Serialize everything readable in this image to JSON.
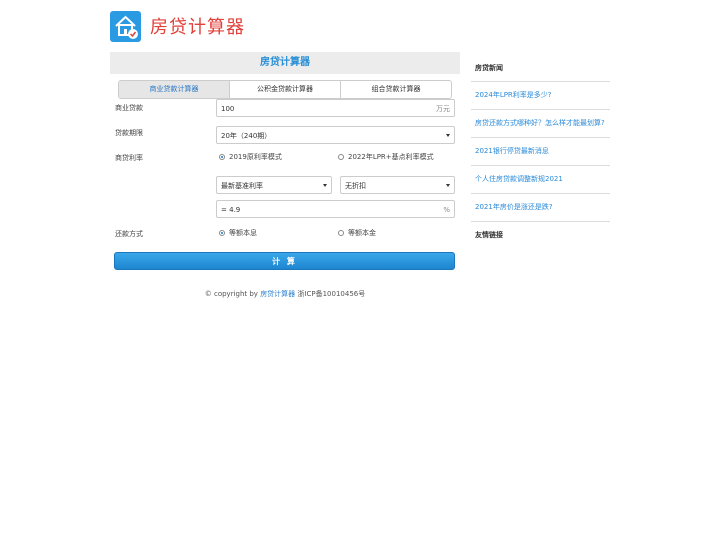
{
  "header": {
    "logo_icon": "house-icon",
    "site_title": "房贷计算器"
  },
  "panel": {
    "title": "房贷计算器"
  },
  "tabs": [
    {
      "label": "商业贷款计算器",
      "active": true
    },
    {
      "label": "公积金贷款计算器",
      "active": false
    },
    {
      "label": "组合贷款计算器",
      "active": false
    }
  ],
  "form": {
    "amount": {
      "label": "商业贷款",
      "value": "100",
      "unit": "万元"
    },
    "term": {
      "label": "贷款期限",
      "value": "20年（240期）"
    },
    "rate": {
      "label": "商贷利率",
      "options": [
        {
          "label": "2019原利率模式",
          "checked": true
        },
        {
          "label": "2022年LPR+基点利率模式",
          "checked": false
        }
      ],
      "base_select": "最新基准利率",
      "discount_select": "无折扣",
      "prefix": "=",
      "value": "4.9",
      "unit": "%"
    },
    "repay": {
      "label": "还款方式",
      "options": [
        {
          "label": "等额本息",
          "checked": true
        },
        {
          "label": "等额本金",
          "checked": false
        }
      ]
    },
    "calc_button": "计 算"
  },
  "footer": {
    "prefix": "© copyright by",
    "link": "房贷计算器",
    "icp": "浙ICP备10010456号"
  },
  "sidebar": {
    "heading": "房贷新闻",
    "items": [
      "2024年LPR利率是多少?",
      "房贷还款方式哪种好？怎么样才能最划算?",
      "2021银行停贷最新消息",
      "个人住房贷款调整新规2021",
      "2021年房价是涨还是跌?"
    ],
    "friend_links": "友情链接"
  },
  "colors": {
    "accent": "#2a90d6",
    "title_red": "#e2403b"
  }
}
